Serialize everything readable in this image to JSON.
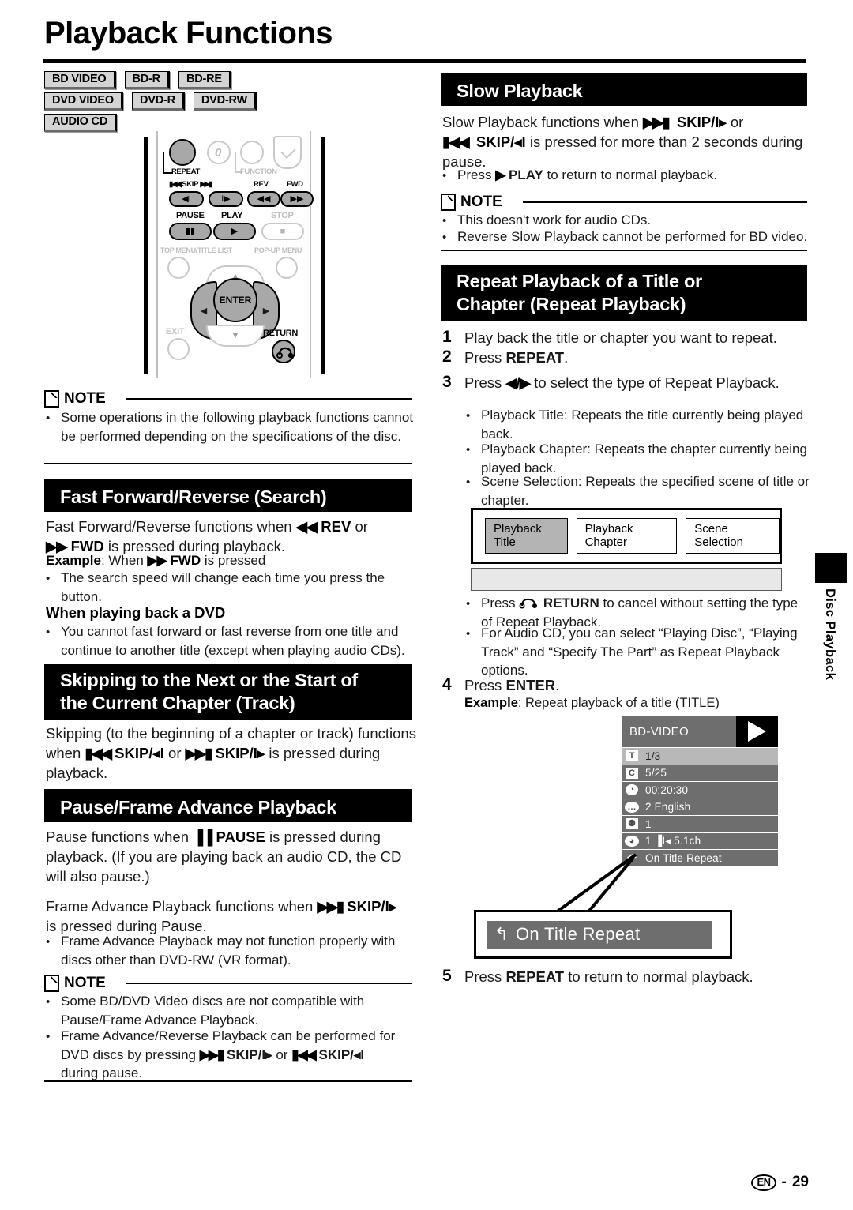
{
  "page": {
    "title": "Playback Functions",
    "footer_locale": "EN",
    "footer_page": "29",
    "side_tab_label": "Disc Playback"
  },
  "disc_badges": [
    [
      "BD VIDEO",
      "BD-R",
      "BD-RE"
    ],
    [
      "DVD VIDEO",
      "DVD-R",
      "DVD-RW"
    ],
    [
      "AUDIO CD"
    ]
  ],
  "remote": {
    "labels": {
      "repeat": "REPEAT",
      "function": "FUNCTION",
      "zero": "0",
      "skip": "SKIP",
      "rev": "REV",
      "fwd": "FWD",
      "pause": "PAUSE",
      "play": "PLAY",
      "stop": "STOP",
      "top_menu": "TOP MENU/TITLE LIST",
      "popup_menu": "POP-UP MENU",
      "enter": "ENTER",
      "exit": "EXIT",
      "return": "RETURN"
    }
  },
  "left_column": {
    "note1": {
      "heading": "NOTE",
      "bullets": [
        "Some operations in the following playback functions cannot be performed depending on the specifications of the disc."
      ]
    },
    "fast_forward": {
      "heading": "Fast Forward/Reverse (Search)",
      "para_a_pre": "Fast Forward/Reverse functions when ",
      "para_a_rev": "REV",
      "para_a_mid": " or",
      "para_b_fwd": "FWD",
      "para_b_post": " is pressed during playback.",
      "example_label": "Example",
      "example_pre": ": When ",
      "example_fwd": "FWD",
      "example_post": " is pressed",
      "bullets": [
        "The search speed will change each time you press the button."
      ],
      "subhead": "When playing back a DVD",
      "subhead_bullets": [
        "You cannot fast forward or fast reverse from one title and continue to another title (except when playing audio CDs)."
      ]
    },
    "skipping": {
      "heading_line1": "Skipping to the Next or the Start of",
      "heading_line2": "the Current Chapter (Track)",
      "para_pre": "Skipping (to the beginning of a chapter or track) functions when ",
      "skip_prev": "SKIP/",
      "skip_prev_sym": "◂I",
      "para_mid": " or ",
      "skip_next": "SKIP/",
      "skip_next_sym": "I▸",
      "para_post": " is pressed during playback."
    },
    "pause_frame": {
      "heading": "Pause/Frame Advance Playback",
      "para_a_pre": "Pause functions when ",
      "para_a_pause": "PAUSE",
      "para_a_post": " is pressed during playback. (If you are playing back an audio CD, the CD will also pause.)",
      "para_b_pre": "Frame Advance Playback functions when ",
      "para_b_skip": "SKIP/",
      "para_b_skip_sym": "I▸",
      "para_b_post": "is pressed during Pause.",
      "bullets": [
        "Frame Advance Playback may not function properly with discs other than DVD-RW (VR format)."
      ],
      "note": {
        "heading": "NOTE",
        "bullets": [
          "Some BD/DVD Video discs are not compatible with Pause/Frame Advance Playback.",
          "Frame Advance/Reverse Playback can be performed for DVD discs by pressing"
        ],
        "bullet2_skip_next": "SKIP/",
        "bullet2_skip_next_sym": "I▸",
        "bullet2_mid": " or ",
        "bullet2_skip_prev": "SKIP/",
        "bullet2_skip_prev_sym": "◂I",
        "bullet2_tail": "during pause."
      }
    }
  },
  "right_column": {
    "slow_playback": {
      "heading": "Slow Playback",
      "para_pre": "Slow Playback functions when ",
      "skip_next": "SKIP/",
      "skip_next_sym": "I▸",
      "para_mid": " or",
      "skip_prev": "SKIP/",
      "skip_prev_sym": "◂I",
      "para_post": " is pressed for more than 2 seconds during pause.",
      "bullets_pre": "Press ",
      "bullets_play": "PLAY",
      "bullets_post": " to return to normal playback.",
      "note": {
        "heading": "NOTE",
        "bullets": [
          "This doesn't work for audio CDs.",
          "Reverse Slow Playback cannot be performed for BD video."
        ]
      }
    },
    "repeat_playback": {
      "heading_line1": "Repeat Playback of a Title or",
      "heading_line2": "Chapter (Repeat Playback)",
      "steps": [
        {
          "num": "1",
          "text": "Play back the title or chapter you want to repeat."
        },
        {
          "num": "2",
          "pre": "Press ",
          "bold": "REPEAT",
          "post": "."
        },
        {
          "num": "3",
          "pre": "Press ",
          "sym": "◀/▶",
          "post": " to select the type of Repeat Playback."
        },
        {
          "num": "4",
          "pre": "Press ",
          "bold": "ENTER",
          "post": "."
        },
        {
          "num": "5",
          "pre": "Press ",
          "bold": "REPEAT",
          "post": " to return to normal playback."
        }
      ],
      "step3_bullets": [
        "Playback Title: Repeats the title currently being played back.",
        "Playback Chapter: Repeats the chapter currently being played back.",
        "Scene Selection: Repeats the specified scene of title or chapter."
      ],
      "options": [
        {
          "label": "Playback Title",
          "selected": true
        },
        {
          "label": "Playback Chapter",
          "selected": false
        },
        {
          "label": "Scene Selection",
          "selected": false
        }
      ],
      "after_options_bullets": [
        {
          "pre": "Press ",
          "icon": "return-icon",
          "bold": "RETURN",
          "post": " to cancel without setting the type of Repeat Playback."
        },
        {
          "pre": "",
          "bold": "",
          "post": "For Audio CD, you can select “Playing Disc”, “Playing Track” and “Specify The Part” as Repeat Playback options."
        }
      ],
      "step4_example_label": "Example",
      "step4_example_text": ": Repeat playback of a title (TITLE)"
    },
    "osd": {
      "disc_type": "BD-VIDEO",
      "rows": [
        {
          "icon": "title-icon",
          "icon_glyph": "T",
          "value": "1/3",
          "highlighted": true
        },
        {
          "icon": "chapter-icon",
          "icon_glyph": "C",
          "value": "5/25",
          "highlighted": false
        },
        {
          "icon": "time-icon",
          "icon_glyph": "◔",
          "value": "00:20:30",
          "highlighted": false
        },
        {
          "icon": "subtitle-icon",
          "icon_glyph": "…",
          "value": "2 English",
          "highlighted": false
        },
        {
          "icon": "angle-icon",
          "icon_glyph": "⚉",
          "value": "1",
          "highlighted": false
        },
        {
          "icon": "audio-icon",
          "icon_glyph": "◕",
          "value": "1   ▐I◂   5.1ch",
          "highlighted": false
        },
        {
          "icon": "repeat-icon",
          "icon_glyph": "↶",
          "value": "On Title Repeat",
          "highlighted": false
        }
      ]
    },
    "callout": {
      "icon": "repeat-icon",
      "text": "On Title Repeat"
    }
  }
}
